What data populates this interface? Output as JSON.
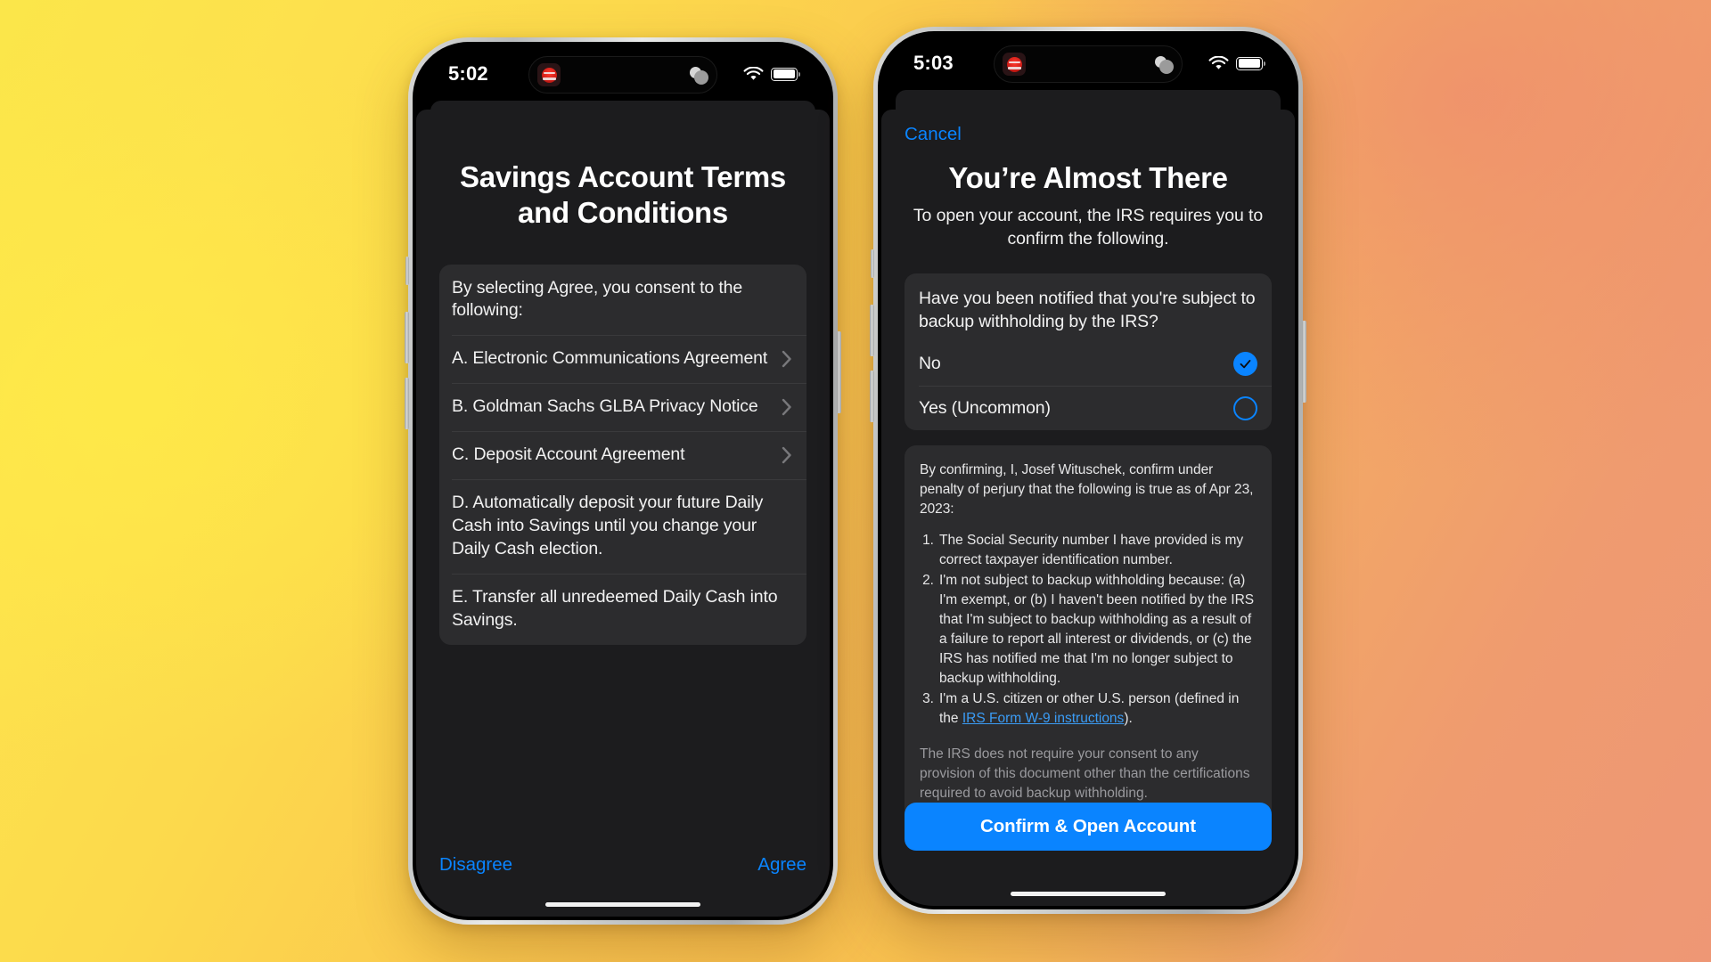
{
  "background": {
    "accent_yellow": "#fbe64a",
    "accent_orange": "#ee9775"
  },
  "colors": {
    "tint_blue": "#0a84ff",
    "card": "#2c2c2e",
    "page": "#1c1c1e",
    "link": "#3b9cf5"
  },
  "phone_left": {
    "status": {
      "time": "5:02",
      "wifi_icon": "wifi-icon",
      "battery_icon": "battery-icon",
      "island_app_icon": "red-app-icon",
      "island_activity_icon": "peach-activity-icon"
    },
    "title": "Savings Account Terms and Conditions",
    "list": [
      {
        "text": "By selecting Agree, you consent to the following:",
        "chevron": false
      },
      {
        "text": "A. Electronic Communications Agreement",
        "chevron": true
      },
      {
        "text": "B. Goldman Sachs GLBA Privacy Notice",
        "chevron": true
      },
      {
        "text": "C. Deposit Account Agreement",
        "chevron": true
      },
      {
        "text": "D. Automatically deposit your future Daily Cash into Savings until you change your Daily Cash election.",
        "chevron": false
      },
      {
        "text": "E. Transfer all unredeemed Daily Cash into Savings.",
        "chevron": false
      }
    ],
    "disagree_label": "Disagree",
    "agree_label": "Agree"
  },
  "phone_right": {
    "status": {
      "time": "5:03",
      "wifi_icon": "wifi-icon",
      "battery_icon": "battery-icon",
      "island_app_icon": "red-app-icon",
      "island_activity_icon": "peach-activity-icon"
    },
    "cancel_label": "Cancel",
    "title": "You’re Almost There",
    "subtitle": "To open your account, the IRS requires you to confirm the following.",
    "question": "Have you been notified that you're subject to backup withholding by the IRS?",
    "options": [
      {
        "label": "No",
        "selected": true
      },
      {
        "label": "Yes (Uncommon)",
        "selected": false
      }
    ],
    "legal_intro": "By confirming, I, Josef Wituschek, confirm under penalty of perjury that the following is true as of Apr 23, 2023:",
    "legal_items": [
      {
        "num": "1.",
        "text": "The Social Security number I have provided is my correct taxpayer identification number."
      },
      {
        "num": "2.",
        "text": "I'm not subject to backup withholding because: (a) I'm exempt, or (b) I haven't been notified by the IRS that I'm subject to backup withholding as a result of a failure to report all interest or dividends, or (c) the IRS has notified me that I'm no longer subject to backup withholding."
      },
      {
        "num": "3.",
        "text_before": "I'm a U.S. citizen or other U.S. person (defined in the ",
        "link": "IRS Form W-9 instructions",
        "text_after": ")."
      }
    ],
    "legal_note": "The IRS does not require your consent to any provision of this document other than the certifications required to avoid backup withholding.",
    "cta_label": "Confirm & Open Account"
  }
}
